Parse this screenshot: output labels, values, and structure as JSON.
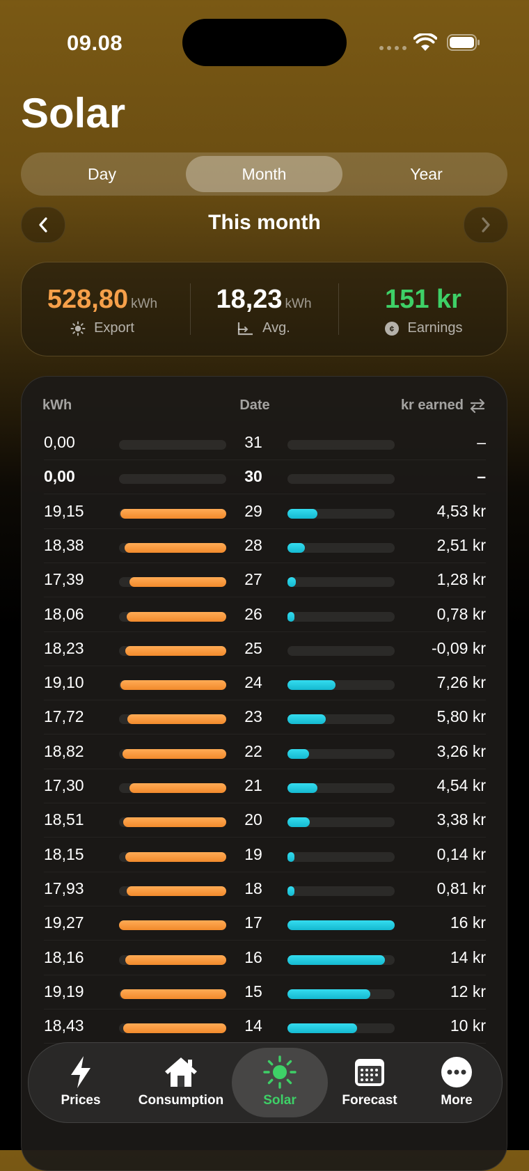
{
  "status_bar": {
    "time": "09.08"
  },
  "page": {
    "title": "Solar"
  },
  "segments": {
    "day": "Day",
    "month": "Month",
    "year": "Year",
    "selected": "Month"
  },
  "period": {
    "label": "This month"
  },
  "summary": {
    "export": {
      "value": "528,80",
      "unit": "kWh",
      "label": "Export",
      "color": "#f6a04a"
    },
    "average": {
      "value": "18,23",
      "unit": "kWh",
      "label": "Avg.",
      "color": "#ffffff"
    },
    "earnings": {
      "value": "151 kr",
      "label": "Earnings",
      "color": "#3ed067"
    }
  },
  "table": {
    "headers": {
      "kwh": "kWh",
      "date": "Date",
      "earned": "kr earned"
    },
    "rows": [
      {
        "kwh": "0,00",
        "date": "31",
        "earned": "–",
        "kwh_fraction": 0,
        "earn_fraction": 0
      },
      {
        "kwh": "0,00",
        "date": "30",
        "earned": "–",
        "kwh_fraction": 0,
        "earn_fraction": 0,
        "bold": true
      },
      {
        "kwh": "19,15",
        "date": "29",
        "earned": "4,53 kr",
        "kwh_fraction": 0.99,
        "earn_fraction": 0.28
      },
      {
        "kwh": "18,38",
        "date": "28",
        "earned": "2,51 kr",
        "kwh_fraction": 0.95,
        "earn_fraction": 0.16
      },
      {
        "kwh": "17,39",
        "date": "27",
        "earned": "1,28 kr",
        "kwh_fraction": 0.9,
        "earn_fraction": 0.08
      },
      {
        "kwh": "18,06",
        "date": "26",
        "earned": "0,78 kr",
        "kwh_fraction": 0.93,
        "earn_fraction": 0.05
      },
      {
        "kwh": "18,23",
        "date": "25",
        "earned": "-0,09 kr",
        "kwh_fraction": 0.94,
        "earn_fraction": 0
      },
      {
        "kwh": "19,10",
        "date": "24",
        "earned": "7,26 kr",
        "kwh_fraction": 0.99,
        "earn_fraction": 0.45
      },
      {
        "kwh": "17,72",
        "date": "23",
        "earned": "5,80 kr",
        "kwh_fraction": 0.92,
        "earn_fraction": 0.36
      },
      {
        "kwh": "18,82",
        "date": "22",
        "earned": "3,26 kr",
        "kwh_fraction": 0.97,
        "earn_fraction": 0.2
      },
      {
        "kwh": "17,30",
        "date": "21",
        "earned": "4,54 kr",
        "kwh_fraction": 0.9,
        "earn_fraction": 0.28
      },
      {
        "kwh": "18,51",
        "date": "20",
        "earned": "3,38 kr",
        "kwh_fraction": 0.96,
        "earn_fraction": 0.21
      },
      {
        "kwh": "18,15",
        "date": "19",
        "earned": "0,14 kr",
        "kwh_fraction": 0.94,
        "earn_fraction": 0.05
      },
      {
        "kwh": "17,93",
        "date": "18",
        "earned": "0,81 kr",
        "kwh_fraction": 0.93,
        "earn_fraction": 0.05
      },
      {
        "kwh": "19,27",
        "date": "17",
        "earned": "16 kr",
        "kwh_fraction": 1.0,
        "earn_fraction": 1.0
      },
      {
        "kwh": "18,16",
        "date": "16",
        "earned": "14 kr",
        "kwh_fraction": 0.94,
        "earn_fraction": 0.91
      },
      {
        "kwh": "19,19",
        "date": "15",
        "earned": "12 kr",
        "kwh_fraction": 0.99,
        "earn_fraction": 0.77
      },
      {
        "kwh": "18,43",
        "date": "14",
        "earned": "10 kr",
        "kwh_fraction": 0.96,
        "earn_fraction": 0.65
      }
    ]
  },
  "tabs": [
    {
      "label": "Prices",
      "icon": "bolt-icon"
    },
    {
      "label": "Consumption",
      "icon": "house-icon"
    },
    {
      "label": "Solar",
      "icon": "sun-icon",
      "active": true,
      "color": "#3ed067"
    },
    {
      "label": "Forecast",
      "icon": "calendar-icon"
    },
    {
      "label": "More",
      "icon": "ellipsis-icon"
    }
  ]
}
